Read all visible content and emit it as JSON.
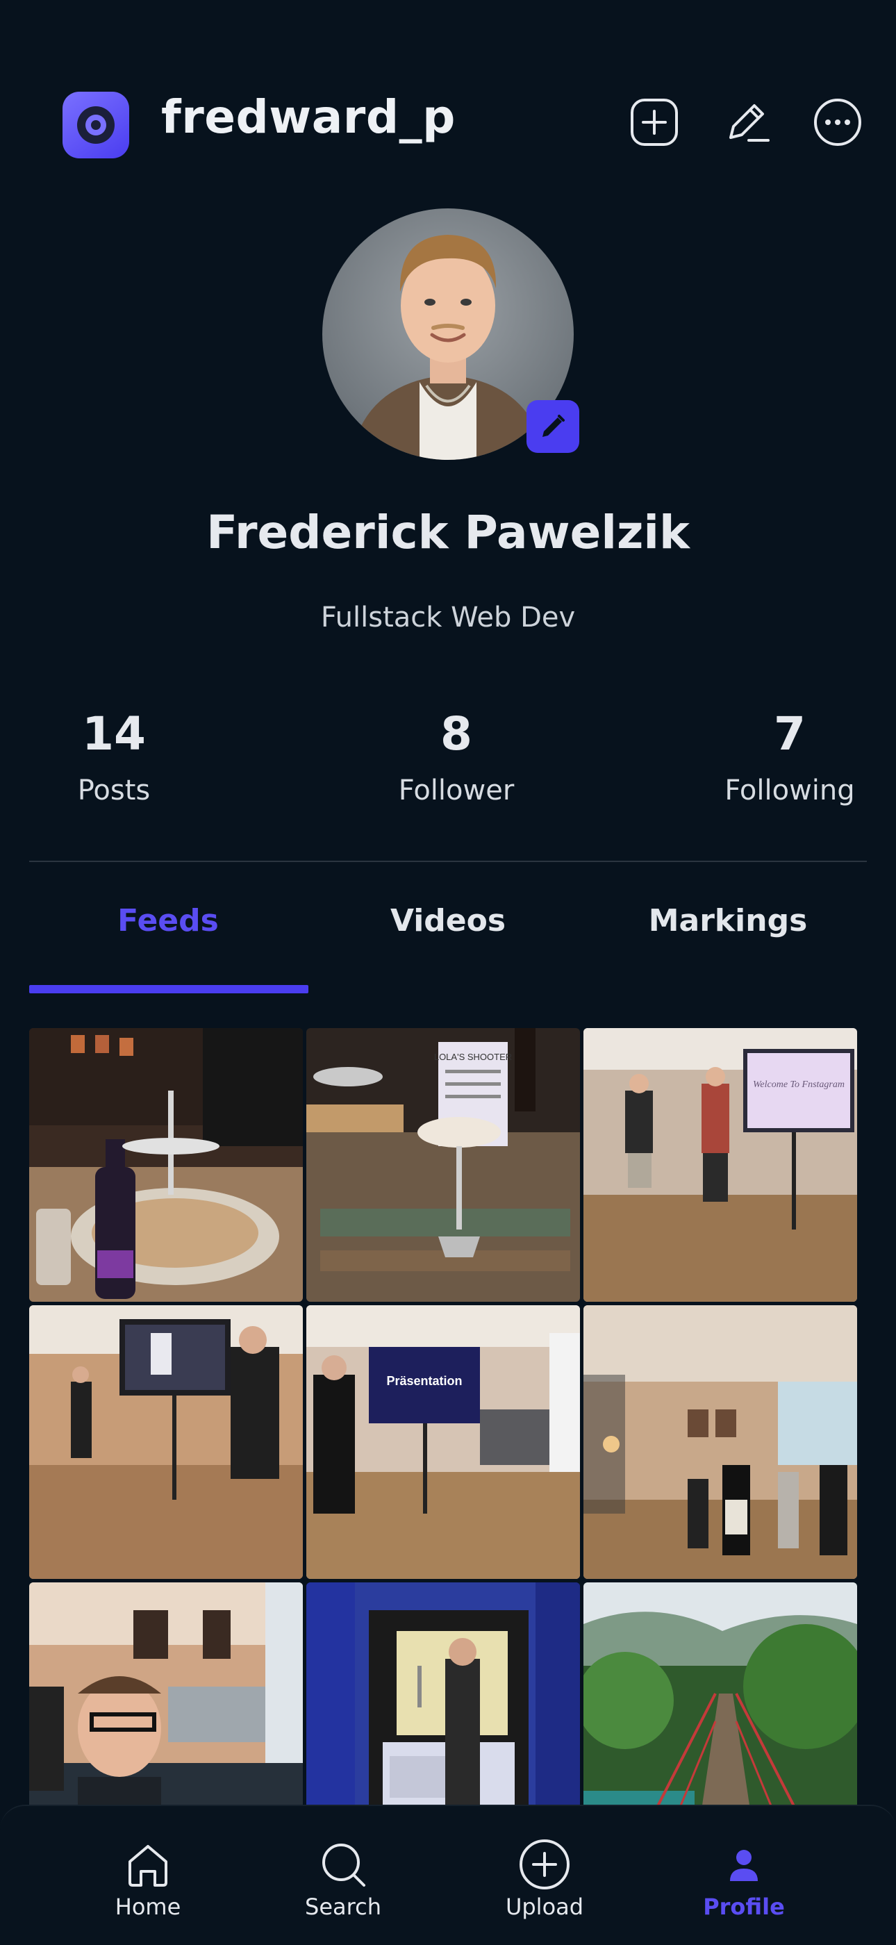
{
  "header": {
    "username": "fredward_p",
    "logo_icon": "camera-lens-icon",
    "actions": [
      {
        "name": "add-post",
        "icon": "plus-circle-icon"
      },
      {
        "name": "edit-profile",
        "icon": "pencil-icon"
      },
      {
        "name": "more",
        "icon": "more-horizontal-icon"
      }
    ]
  },
  "profile": {
    "full_name": "Frederick Pawelzik",
    "bio": "Fullstack Web Dev",
    "avatar_edit_icon": "pencil-icon"
  },
  "stats": [
    {
      "value": "14",
      "label": "Posts"
    },
    {
      "value": "8",
      "label": "Follower"
    },
    {
      "value": "7",
      "label": "Following"
    }
  ],
  "tabs": [
    {
      "label": "Feeds",
      "active": true
    },
    {
      "label": "Videos",
      "active": false
    },
    {
      "label": "Markings",
      "active": false
    }
  ],
  "nav": [
    {
      "label": "Home",
      "icon": "home-icon",
      "active": false
    },
    {
      "label": "Search",
      "icon": "search-icon",
      "active": false
    },
    {
      "label": "Upload",
      "icon": "plus-circle-icon",
      "active": false
    },
    {
      "label": "Profile",
      "icon": "user-icon",
      "active": true
    }
  ],
  "colors": {
    "background": "#07121d",
    "accent": "#4a3df0",
    "text": "#e9edf2"
  },
  "tile_texts": {
    "t1": "LOLA'S SHOOTER",
    "t2": "Welcome To Fnstagram",
    "t3": "Präsentation"
  }
}
